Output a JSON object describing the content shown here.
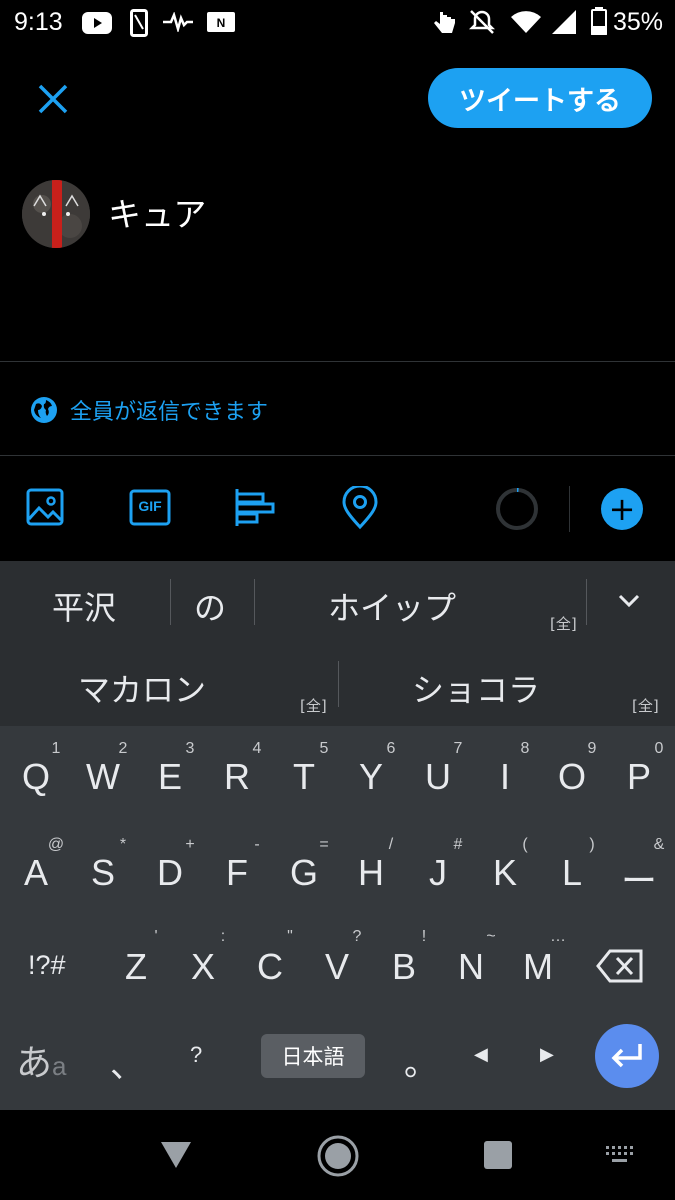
{
  "status_bar": {
    "time": "9:13",
    "battery_percent": "35%",
    "left_icons": [
      "youtube-icon",
      "phone-outline-icon",
      "pulse-icon",
      "nfc-icon"
    ],
    "right_icons": [
      "touch-icon",
      "mute-icon",
      "wifi-icon",
      "signal-icon",
      "battery-icon"
    ]
  },
  "compose": {
    "close_icon": "close-icon",
    "tweet_button": "ツイートする",
    "tweet_text": "キュア",
    "reply_setting": "全員が返信できます"
  },
  "toolbar": {
    "icons": [
      "image-icon",
      "gif-icon",
      "poll-icon",
      "location-icon",
      "char-counter-ring",
      "add-icon"
    ],
    "gif_label": "GIF",
    "add_label": "+"
  },
  "ime_candidates": {
    "row1": [
      {
        "text": "平沢",
        "badge": ""
      },
      {
        "text": "の",
        "badge": ""
      },
      {
        "text": "ホイップ",
        "badge": "[全]"
      }
    ],
    "row2": [
      {
        "text": "マカロン",
        "badge": "[全]"
      },
      {
        "text": "ショコラ",
        "badge": "[全]"
      }
    ],
    "expand_icon": "chevron-down-icon"
  },
  "keyboard": {
    "row1": [
      {
        "key": "Q",
        "hint": "1"
      },
      {
        "key": "W",
        "hint": "2"
      },
      {
        "key": "E",
        "hint": "3"
      },
      {
        "key": "R",
        "hint": "4"
      },
      {
        "key": "T",
        "hint": "5"
      },
      {
        "key": "Y",
        "hint": "6"
      },
      {
        "key": "U",
        "hint": "7"
      },
      {
        "key": "I",
        "hint": "8"
      },
      {
        "key": "O",
        "hint": "9"
      },
      {
        "key": "P",
        "hint": "0"
      }
    ],
    "row2": [
      {
        "key": "A",
        "hint": "@"
      },
      {
        "key": "S",
        "hint": "*"
      },
      {
        "key": "D",
        "hint": "+"
      },
      {
        "key": "F",
        "hint": "-"
      },
      {
        "key": "G",
        "hint": "="
      },
      {
        "key": "H",
        "hint": "/"
      },
      {
        "key": "J",
        "hint": "#"
      },
      {
        "key": "K",
        "hint": "("
      },
      {
        "key": "L",
        "hint": ")"
      },
      {
        "key": "ー",
        "hint": "&"
      }
    ],
    "row3": [
      {
        "key": "Z",
        "hint": "'"
      },
      {
        "key": "X",
        "hint": ":"
      },
      {
        "key": "C",
        "hint": "\""
      },
      {
        "key": "V",
        "hint": "?"
      },
      {
        "key": "B",
        "hint": "!"
      },
      {
        "key": "N",
        "hint": "~"
      },
      {
        "key": "M",
        "hint": "…"
      }
    ],
    "symbols_key": "!?#",
    "backspace_icon": "backspace-icon",
    "kana_toggle_main": "あ",
    "kana_toggle_sub": "a",
    "comma_key": "、",
    "question_key": "?",
    "language_key": "日本語",
    "period_key": "。",
    "left_arrow": "◀",
    "right_arrow": "▶",
    "enter_icon": "enter-icon"
  },
  "nav_bar": {
    "icons": [
      "back-triangle-icon",
      "home-circle-icon",
      "recents-square-icon",
      "keyboard-switch-icon"
    ]
  },
  "colors": {
    "accent": "#1da1f2",
    "background": "#000000",
    "candidate_bar": "#2b2e31",
    "keyboard_bg": "#35393d",
    "enter_key": "#5b8dee"
  }
}
